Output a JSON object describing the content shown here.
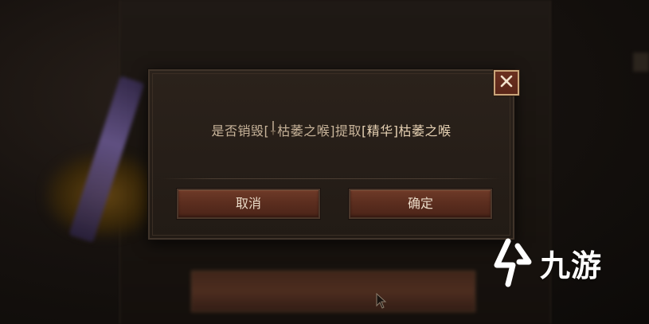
{
  "background": {
    "panel_title": "",
    "panel_subtitle": "",
    "bottom_button_text": ""
  },
  "dialog": {
    "message": {
      "lead": "是否销毁",
      "open_bracket": "[",
      "item_icon": "sword-icon",
      "item_name": "枯萎之喉",
      "close_bracket": "]",
      "extract_word": "提取",
      "reward": "[精华]枯萎之喉"
    },
    "cancel_label": "取消",
    "confirm_label": "确定",
    "close_icon": "close-icon"
  },
  "watermark": {
    "text": "九游",
    "logo_icon": "jiuyou-logo"
  },
  "colors": {
    "dialog_bg": "#261e18",
    "button_bg": "#5c2e1f",
    "close_border": "#c9a57a",
    "text": "#c8b49a"
  }
}
